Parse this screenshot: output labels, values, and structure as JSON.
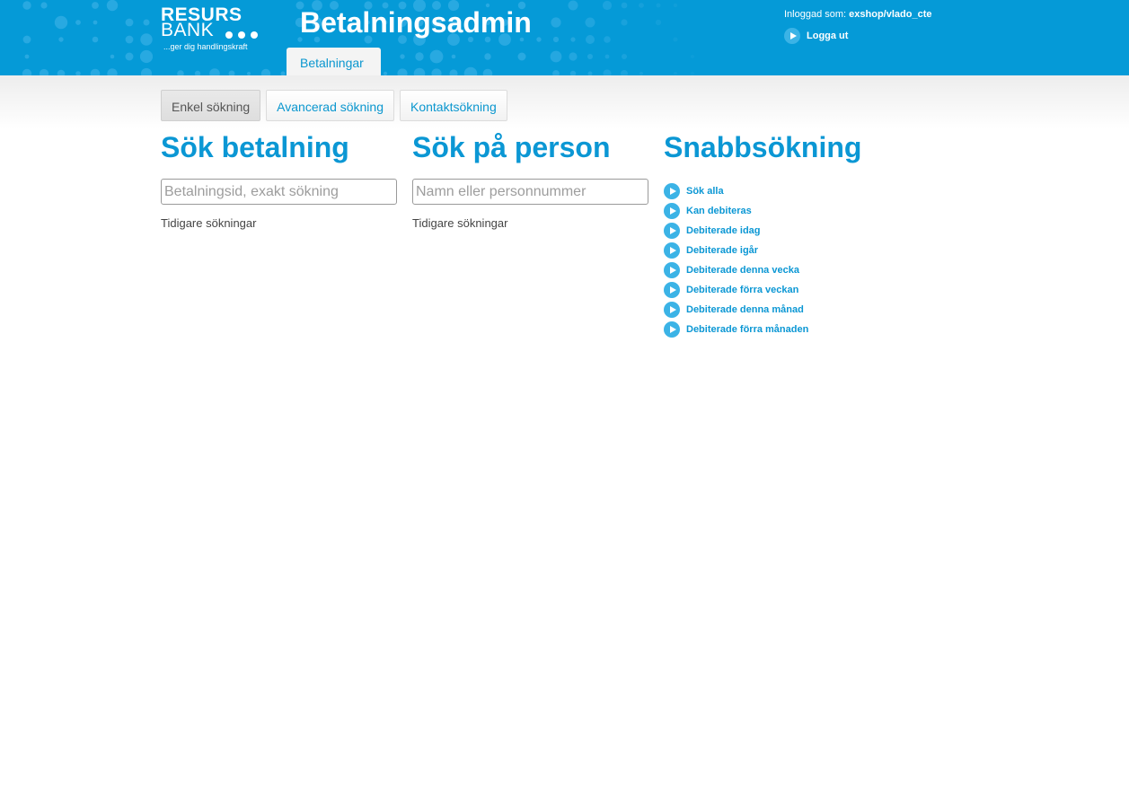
{
  "header": {
    "logo": {
      "line1": "RESURS",
      "line2": "BANK",
      "tagline": "...ger dig handlingskraft"
    },
    "app_title": "Betalningsadmin",
    "main_tab": "Betalningar",
    "user_prefix": "Inloggad som:",
    "username": "exshop/vlado_cte",
    "logout_label": "Logga ut"
  },
  "subtabs": [
    {
      "label": "Enkel sökning",
      "active": true
    },
    {
      "label": "Avancerad sökning",
      "active": false
    },
    {
      "label": "Kontaktsökning",
      "active": false
    }
  ],
  "search_payment": {
    "title": "Sök betalning",
    "placeholder": "Betalningsid, exakt sökning",
    "value": "",
    "previous_label": "Tidigare sökningar"
  },
  "search_person": {
    "title": "Sök på person",
    "placeholder": "Namn eller personnummer",
    "value": "",
    "previous_label": "Tidigare sökningar"
  },
  "quick_search": {
    "title": "Snabbsökning",
    "items": [
      {
        "label": "Sök alla",
        "icon": "play-circle-icon"
      },
      {
        "label": "Kan debiteras",
        "icon": "play-circle-icon"
      },
      {
        "label": "Debiterade idag",
        "icon": "play-circle-icon"
      },
      {
        "label": "Debiterade igår",
        "icon": "play-circle-icon"
      },
      {
        "label": "Debiterade denna vecka",
        "icon": "play-circle-icon"
      },
      {
        "label": "Debiterade förra veckan",
        "icon": "play-circle-icon"
      },
      {
        "label": "Debiterade denna månad",
        "icon": "play-circle-icon"
      },
      {
        "label": "Debiterade förra månaden",
        "icon": "play-circle-icon"
      }
    ]
  },
  "colors": {
    "header_bg": "#059ad7",
    "accent": "#0b97d4",
    "icon_bg": "#3bb3e6"
  }
}
